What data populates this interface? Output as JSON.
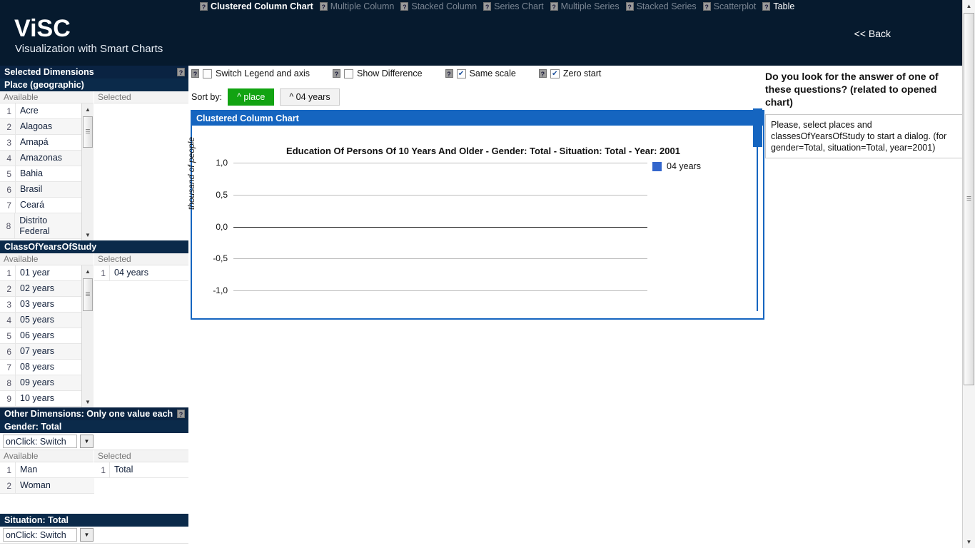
{
  "header": {
    "logo": "ViSC",
    "tagline": "Visualization with Smart Charts",
    "back_label": "<< Back"
  },
  "nav": {
    "help_badge": "?",
    "tabs": [
      {
        "label": "Clustered Column Chart",
        "state": "active"
      },
      {
        "label": "Multiple Column",
        "state": "disabled"
      },
      {
        "label": "Stacked Column",
        "state": "disabled"
      },
      {
        "label": "Series Chart",
        "state": "disabled"
      },
      {
        "label": "Multiple Series",
        "state": "disabled"
      },
      {
        "label": "Stacked Series",
        "state": "disabled"
      },
      {
        "label": "Scatterplot",
        "state": "disabled"
      },
      {
        "label": "Table",
        "state": "enabled"
      }
    ]
  },
  "sidebar": {
    "selected_dimensions_title": "Selected Dimensions",
    "other_dimensions_title": "Other Dimensions: Only one value each",
    "available_header": "Available",
    "selected_header": "Selected",
    "place": {
      "title": "Place (geographic)",
      "available": [
        "Acre",
        "Alagoas",
        "Amapá",
        "Amazonas",
        "Bahia",
        "Brasil",
        "Ceará",
        "Distrito Federal"
      ],
      "selected": []
    },
    "class_of_years": {
      "title": "ClassOfYearsOfStudy",
      "available": [
        "01 year",
        "02 years",
        "03 years",
        "05 years",
        "06 years",
        "07 years",
        "08 years",
        "09 years",
        "10 years"
      ],
      "selected": [
        "04 years"
      ]
    },
    "gender": {
      "title": "Gender: Total",
      "onclick_label": "onClick: Switch",
      "available": [
        "Man",
        "Woman"
      ],
      "selected": [
        "Total"
      ]
    },
    "situation": {
      "title": "Situation: Total",
      "onclick_label": "onClick: Switch"
    }
  },
  "toolbar": {
    "options": [
      {
        "label": "Switch Legend and axis",
        "checked": false
      },
      {
        "label": "Show Difference",
        "checked": false
      },
      {
        "label": "Same scale",
        "checked": true
      },
      {
        "label": "Zero start",
        "checked": true
      }
    ],
    "sort_label": "Sort by:",
    "sort_buttons": [
      {
        "label": "^ place",
        "active": true
      },
      {
        "label": "^ 04 years",
        "active": false
      }
    ]
  },
  "chart_panel": {
    "header": "Clustered Column Chart"
  },
  "right_panel": {
    "title": "Do you look for the answer of one of these questions? (related to opened chart)",
    "message": "Please, select places and classesOfYearsOfStudy to start a dialog. (for gender=Total, situation=Total, year=2001)"
  },
  "chart_data": {
    "type": "bar",
    "title": "Education Of Persons Of 10 Years And Older - Gender: Total - Situation: Total - Year: 2001",
    "xlabel": "",
    "ylabel": "thousand of people",
    "categories": [],
    "series": [
      {
        "name": "04 years",
        "color": "#3366cc",
        "values": []
      }
    ],
    "ylim": [
      -1.0,
      1.0
    ],
    "yticks": [
      "1,0",
      "0,5",
      "0,0",
      "-0,5",
      "-1,0"
    ],
    "grid": true,
    "legend_position": "right",
    "legend": [
      "04 years"
    ],
    "note": "empty chart - no places selected"
  }
}
